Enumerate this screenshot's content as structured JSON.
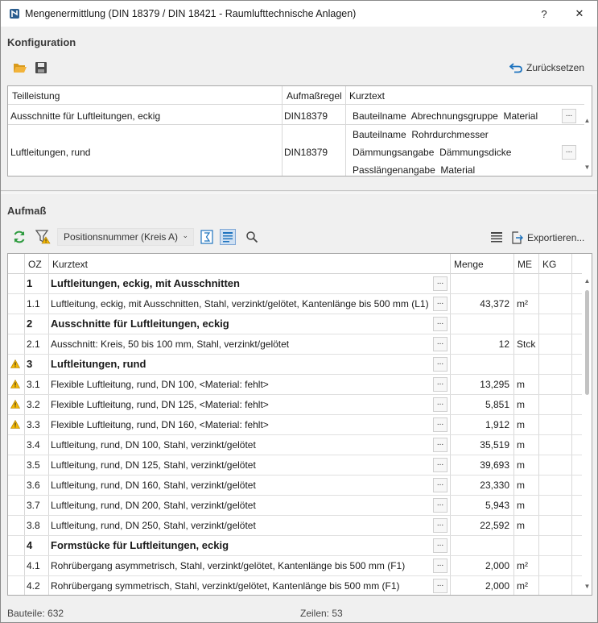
{
  "window": {
    "title": "Mengenermittlung (DIN 18379 / DIN 18421 - Raumlufttechnische Anlagen)",
    "help": "?",
    "close": "✕"
  },
  "konfiguration": {
    "title": "Konfiguration",
    "reset_label": "Zurücksetzen",
    "columns": [
      "Teilleistung",
      "Aufmaßregel",
      "Kurztext"
    ],
    "rows": [
      {
        "teilleistung": "Ausschnitte für Luftleitungen, eckig",
        "regel": "DIN18379",
        "kurztext": [
          "Bauteilname  Abrechnungsgruppe  Material"
        ]
      },
      {
        "teilleistung": "Luftleitungen, rund",
        "regel": "DIN18379",
        "kurztext": [
          "Bauteilname  Rohrdurchmesser",
          "Dämmungsangabe  Dämmungsdicke",
          "Passlängenangabe  Material"
        ]
      }
    ]
  },
  "aufmass": {
    "title": "Aufmaß",
    "sort_select": "Positionsnummer (Kreis A)",
    "export_label": "Exportieren...",
    "columns": [
      "OZ",
      "Kurztext",
      "Menge",
      "ME",
      "KG"
    ],
    "rows": [
      {
        "oz": "1",
        "kurztext": "Luftleitungen, eckig, mit Ausschnitten",
        "menge": "",
        "me": "",
        "group": true,
        "warn": false
      },
      {
        "oz": "1.1",
        "kurztext": "Luftleitung, eckig, mit Ausschnitten, Stahl, verzinkt/gelötet, Kantenlänge bis 500 mm (L1)",
        "menge": "43,372",
        "me": "m²",
        "group": false,
        "warn": false
      },
      {
        "oz": "2",
        "kurztext": "Ausschnitte für Luftleitungen, eckig",
        "menge": "",
        "me": "",
        "group": true,
        "warn": false
      },
      {
        "oz": "2.1",
        "kurztext": "Ausschnitt: Kreis, 50 bis 100 mm, Stahl, verzinkt/gelötet",
        "menge": "12",
        "me": "Stck",
        "group": false,
        "warn": false
      },
      {
        "oz": "3",
        "kurztext": "Luftleitungen, rund",
        "menge": "",
        "me": "",
        "group": true,
        "warn": true
      },
      {
        "oz": "3.1",
        "kurztext": "Flexible Luftleitung, rund, DN 100, <Material: fehlt>",
        "menge": "13,295",
        "me": "m",
        "group": false,
        "warn": true
      },
      {
        "oz": "3.2",
        "kurztext": "Flexible Luftleitung, rund, DN 125, <Material: fehlt>",
        "menge": "5,851",
        "me": "m",
        "group": false,
        "warn": true
      },
      {
        "oz": "3.3",
        "kurztext": "Flexible Luftleitung, rund, DN 160, <Material: fehlt>",
        "menge": "1,912",
        "me": "m",
        "group": false,
        "warn": true
      },
      {
        "oz": "3.4",
        "kurztext": "Luftleitung, rund, DN 100, Stahl, verzinkt/gelötet",
        "menge": "35,519",
        "me": "m",
        "group": false,
        "warn": false
      },
      {
        "oz": "3.5",
        "kurztext": "Luftleitung, rund, DN 125, Stahl, verzinkt/gelötet",
        "menge": "39,693",
        "me": "m",
        "group": false,
        "warn": false
      },
      {
        "oz": "3.6",
        "kurztext": "Luftleitung, rund, DN 160, Stahl, verzinkt/gelötet",
        "menge": "23,330",
        "me": "m",
        "group": false,
        "warn": false
      },
      {
        "oz": "3.7",
        "kurztext": "Luftleitung, rund, DN 200, Stahl, verzinkt/gelötet",
        "menge": "5,943",
        "me": "m",
        "group": false,
        "warn": false
      },
      {
        "oz": "3.8",
        "kurztext": "Luftleitung, rund, DN 250, Stahl, verzinkt/gelötet",
        "menge": "22,592",
        "me": "m",
        "group": false,
        "warn": false
      },
      {
        "oz": "4",
        "kurztext": "Formstücke für Luftleitungen, eckig",
        "menge": "",
        "me": "",
        "group": true,
        "warn": false
      },
      {
        "oz": "4.1",
        "kurztext": "Rohrübergang asymmetrisch, Stahl, verzinkt/gelötet, Kantenlänge bis 500 mm (F1)",
        "menge": "2,000",
        "me": "m²",
        "group": false,
        "warn": false
      },
      {
        "oz": "4.2",
        "kurztext": "Rohrübergang symmetrisch, Stahl, verzinkt/gelötet, Kantenlänge bis 500 mm (F1)",
        "menge": "2,000",
        "me": "m²",
        "group": false,
        "warn": false
      }
    ]
  },
  "status": {
    "bauteile": "Bauteile: 632",
    "zeilen": "Zeilen: 53"
  },
  "colors": {
    "accent": "#1e73be",
    "warning": "#f2b705",
    "refresh": "#2e9b3f",
    "folder": "#e8a020"
  }
}
